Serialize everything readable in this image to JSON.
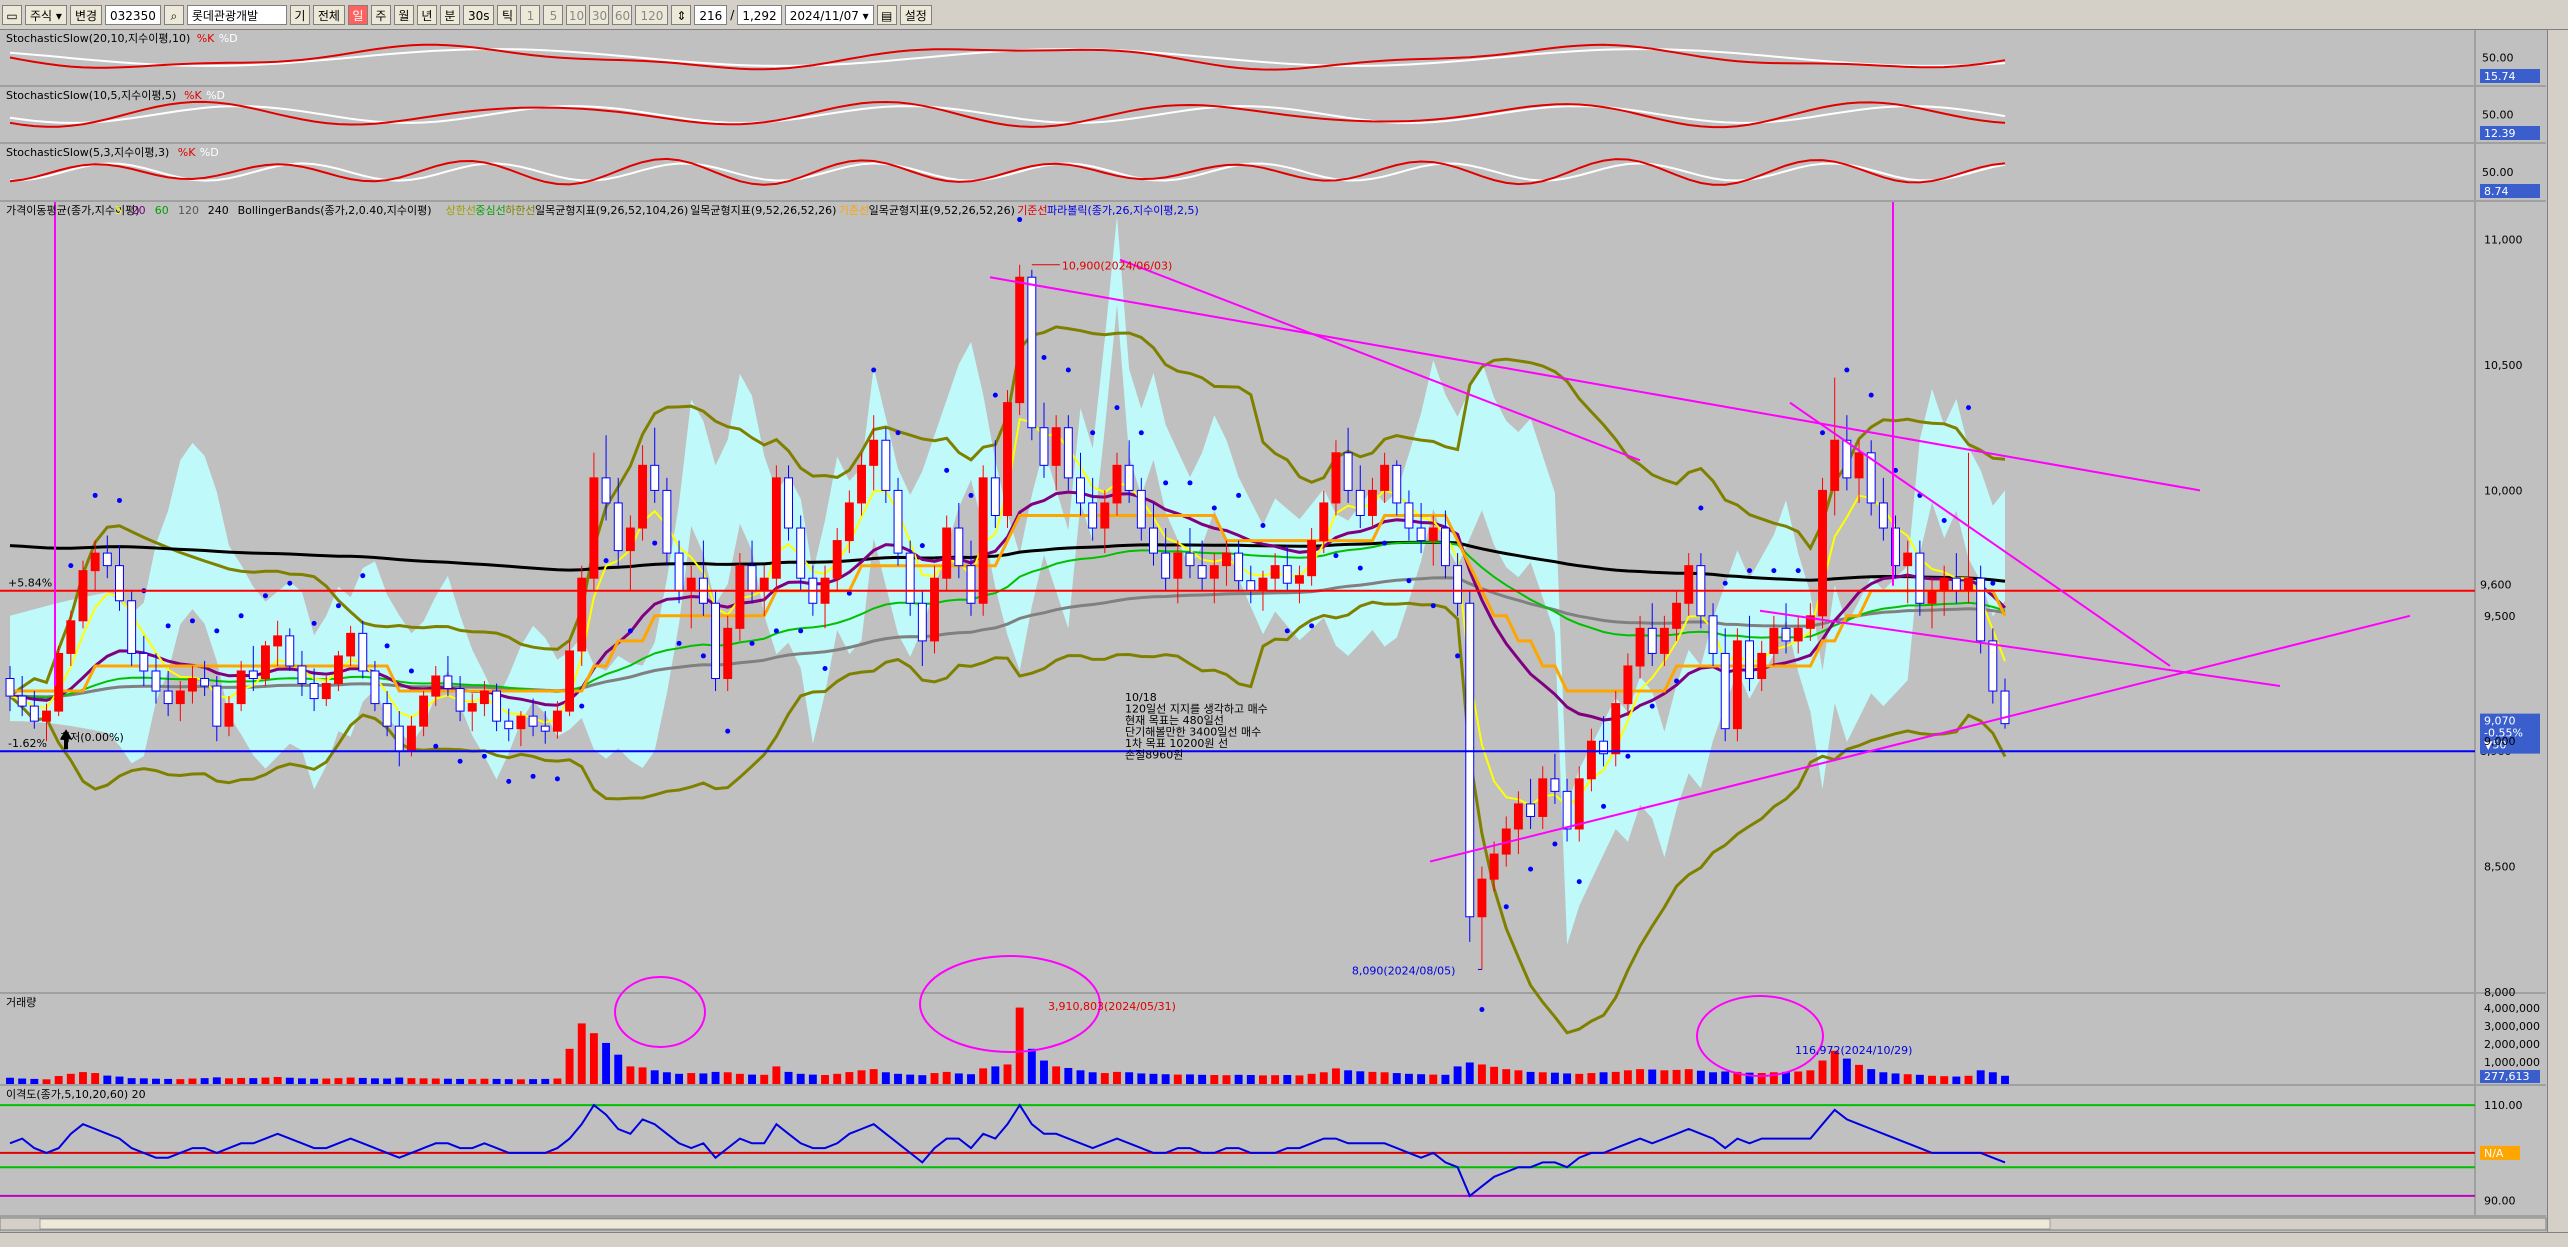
{
  "toolbar": {
    "market_label": "주식",
    "change_label": "변경",
    "code": "032350",
    "name": "롯데관광개발",
    "period_label": "기",
    "all_label": "전체",
    "day_label": "일",
    "week_label": "주",
    "month_label": "월",
    "year_label": "년",
    "minute_label": "분",
    "sec30_label": "30s",
    "tick_label": "틱",
    "intervals": [
      "1",
      "5",
      "10",
      "30",
      "60",
      "120"
    ],
    "count": "216",
    "zoom": "1,292",
    "date": "2024/11/07",
    "settings_label": "설정"
  },
  "colors": {
    "candle_up": "#ff0000",
    "candle_down": "#0000ff",
    "ichimoku_cloud": "#c0ffff",
    "ma5": "#ffff00",
    "ma20": "#800080",
    "ma60": "#00c000",
    "ma120": "#808080",
    "ma240": "#000000",
    "bollinger": "#808000",
    "envelope": "#ffa500",
    "trendline": "#ff00ff",
    "support": "#0000ff",
    "resistance": "#ff0000"
  },
  "panels": {
    "stoch1": {
      "title": "StochasticSlow(20,10,지수이평,10)",
      "k": "%K",
      "d": "%D",
      "level": "50.00",
      "value": "15.74"
    },
    "stoch2": {
      "title": "StochasticSlow(10,5,지수이평,5)",
      "k": "%K",
      "d": "%D",
      "level": "50.00",
      "value": "12.39"
    },
    "stoch3": {
      "title": "StochasticSlow(5,3,지수이평,3)",
      "k": "%K",
      "d": "%D",
      "level": "50.00",
      "value": "8.74"
    },
    "price": {
      "legend": [
        "가격이동평균(종가,지수이평)",
        "5",
        "20",
        "60",
        "120",
        "240",
        "BollingerBands(종가,2,0.40,지수이평)",
        "상한선",
        "중심선",
        "하한선",
        "일목균형지표(9,26,52,104,26)",
        "일목균형지표(9,52,26,52,26)",
        "기준선",
        "일목균형지표(9,52,26,52,26)",
        "기준선",
        "파라볼릭(종가,26,지수이평,2,5)"
      ],
      "high_label": "10,900(2024/06/03)",
      "low_label": "8,090(2024/08/05)",
      "ref_high": "+5.84%",
      "ref_low": "-1.62%",
      "low_marker": "최저(0.00%)",
      "note": [
        "10/18",
        "120일선 지지를 생각하고 매수",
        "현재 목표는 480일선",
        "단기해볼만한 3400일선 매수",
        "1차 목표 10200원 선",
        "손절8960원"
      ],
      "resistance": "9,600",
      "support": "8,960",
      "current_price": "9,070",
      "current_change": "-0.55%",
      "current_diff": "▼50",
      "ticks": [
        "11,000",
        "10,500",
        "10,000",
        "9,500",
        "9,000",
        "8,500",
        "8,000"
      ]
    },
    "volume": {
      "title": "거래량",
      "peak1": "3,910,803(2024/05/31)",
      "peak2": "116,972(2024/10/29)",
      "ticks": [
        "4,000,000",
        "3,000,000",
        "2,000,000",
        "1,000,000"
      ],
      "last": "277,613"
    },
    "disparity": {
      "title": "이격도(종가,5,10,20,60)",
      "param": "20",
      "ticks": [
        "110.00",
        "90.00"
      ],
      "value": "N/A"
    }
  },
  "chart_data": {
    "type": "candlestick",
    "title": "롯데관광개발",
    "ylim": [
      8000,
      11150
    ],
    "resistance": 9600,
    "support": 8960,
    "high": {
      "value": 10900,
      "date": "2024/06/03"
    },
    "low": {
      "value": 8090,
      "date": "2024/08/05"
    },
    "candles": [
      [
        9250,
        9300,
        9120,
        9180
      ],
      [
        9180,
        9260,
        9100,
        9140
      ],
      [
        9140,
        9200,
        9050,
        9080
      ],
      [
        9080,
        9150,
        9000,
        9120
      ],
      [
        9120,
        9380,
        9100,
        9350
      ],
      [
        9350,
        9520,
        9300,
        9480
      ],
      [
        9480,
        9720,
        9450,
        9680
      ],
      [
        9680,
        9800,
        9600,
        9750
      ],
      [
        9750,
        9820,
        9650,
        9700
      ],
      [
        9700,
        9780,
        9520,
        9560
      ],
      [
        9560,
        9600,
        9300,
        9350
      ],
      [
        9350,
        9420,
        9220,
        9280
      ],
      [
        9280,
        9350,
        9150,
        9200
      ],
      [
        9200,
        9280,
        9100,
        9150
      ],
      [
        9150,
        9240,
        9080,
        9200
      ],
      [
        9200,
        9300,
        9150,
        9250
      ],
      [
        9250,
        9320,
        9180,
        9220
      ],
      [
        9220,
        9260,
        9000,
        9060
      ],
      [
        9060,
        9180,
        9020,
        9150
      ],
      [
        9150,
        9320,
        9120,
        9280
      ],
      [
        9280,
        9380,
        9200,
        9250
      ],
      [
        9250,
        9400,
        9220,
        9380
      ],
      [
        9380,
        9480,
        9300,
        9420
      ],
      [
        9420,
        9450,
        9280,
        9300
      ],
      [
        9300,
        9360,
        9180,
        9230
      ],
      [
        9230,
        9290,
        9120,
        9170
      ],
      [
        9170,
        9260,
        9140,
        9230
      ],
      [
        9230,
        9360,
        9200,
        9340
      ],
      [
        9340,
        9460,
        9300,
        9430
      ],
      [
        9430,
        9480,
        9250,
        9280
      ],
      [
        9280,
        9320,
        9120,
        9150
      ],
      [
        9150,
        9200,
        9020,
        9060
      ],
      [
        9060,
        9120,
        8900,
        8960
      ],
      [
        8960,
        9100,
        8940,
        9060
      ],
      [
        9060,
        9200,
        9020,
        9180
      ],
      [
        9180,
        9300,
        9140,
        9260
      ],
      [
        9260,
        9340,
        9180,
        9210
      ],
      [
        9210,
        9260,
        9080,
        9120
      ],
      [
        9120,
        9190,
        9040,
        9150
      ],
      [
        9150,
        9240,
        9100,
        9200
      ],
      [
        9200,
        9230,
        9040,
        9080
      ],
      [
        9080,
        9130,
        9000,
        9050
      ],
      [
        9050,
        9120,
        8980,
        9100
      ],
      [
        9100,
        9170,
        9020,
        9060
      ],
      [
        9060,
        9120,
        8990,
        9040
      ],
      [
        9040,
        9160,
        9010,
        9120
      ],
      [
        9120,
        9400,
        9100,
        9360
      ],
      [
        9360,
        9700,
        9300,
        9650
      ],
      [
        9650,
        10150,
        9600,
        10050
      ],
      [
        10050,
        10220,
        9880,
        9950
      ],
      [
        9950,
        10050,
        9700,
        9760
      ],
      [
        9760,
        9900,
        9600,
        9850
      ],
      [
        9850,
        10180,
        9800,
        10100
      ],
      [
        10100,
        10250,
        9950,
        10000
      ],
      [
        10000,
        10050,
        9700,
        9750
      ],
      [
        9750,
        9800,
        9550,
        9600
      ],
      [
        9600,
        9700,
        9450,
        9650
      ],
      [
        9650,
        9800,
        9500,
        9550
      ],
      [
        9550,
        9600,
        9200,
        9250
      ],
      [
        9250,
        9500,
        9200,
        9450
      ],
      [
        9450,
        9750,
        9400,
        9700
      ],
      [
        9700,
        9800,
        9550,
        9600
      ],
      [
        9600,
        9700,
        9500,
        9650
      ],
      [
        9650,
        10100,
        9600,
        10050
      ],
      [
        10050,
        10100,
        9800,
        9850
      ],
      [
        9850,
        9900,
        9600,
        9650
      ],
      [
        9650,
        9700,
        9500,
        9550
      ],
      [
        9550,
        9700,
        9450,
        9650
      ],
      [
        9650,
        9850,
        9600,
        9800
      ],
      [
        9800,
        10000,
        9750,
        9950
      ],
      [
        9950,
        10150,
        9900,
        10100
      ],
      [
        10100,
        10300,
        10000,
        10200
      ],
      [
        10200,
        10250,
        9950,
        10000
      ],
      [
        10000,
        10050,
        9700,
        9750
      ],
      [
        9750,
        9800,
        9500,
        9550
      ],
      [
        9550,
        9600,
        9300,
        9400
      ],
      [
        9400,
        9700,
        9350,
        9650
      ],
      [
        9650,
        9900,
        9600,
        9850
      ],
      [
        9850,
        9950,
        9650,
        9700
      ],
      [
        9700,
        9800,
        9500,
        9550
      ],
      [
        9550,
        10100,
        9500,
        10050
      ],
      [
        10050,
        10200,
        9850,
        9900
      ],
      [
        9900,
        10400,
        9850,
        10350
      ],
      [
        10350,
        10900,
        10300,
        10850
      ],
      [
        10850,
        10880,
        10200,
        10250
      ],
      [
        10250,
        10350,
        10050,
        10100
      ],
      [
        10100,
        10300,
        10000,
        10250
      ],
      [
        10250,
        10300,
        10000,
        10050
      ],
      [
        10050,
        10150,
        9900,
        9950
      ],
      [
        9950,
        10050,
        9800,
        9850
      ],
      [
        9850,
        10000,
        9750,
        9950
      ],
      [
        9950,
        10150,
        9900,
        10100
      ],
      [
        10100,
        10200,
        9950,
        10000
      ],
      [
        10000,
        10050,
        9800,
        9850
      ],
      [
        9850,
        9950,
        9700,
        9750
      ],
      [
        9750,
        9850,
        9600,
        9650
      ],
      [
        9650,
        9800,
        9550,
        9750
      ],
      [
        9750,
        9850,
        9650,
        9700
      ],
      [
        9700,
        9800,
        9600,
        9650
      ],
      [
        9650,
        9750,
        9550,
        9700
      ],
      [
        9700,
        9800,
        9620,
        9750
      ],
      [
        9750,
        9800,
        9600,
        9640
      ],
      [
        9640,
        9700,
        9550,
        9600
      ],
      [
        9600,
        9680,
        9520,
        9650
      ],
      [
        9650,
        9750,
        9600,
        9700
      ],
      [
        9700,
        9780,
        9600,
        9630
      ],
      [
        9630,
        9700,
        9550,
        9660
      ],
      [
        9660,
        9850,
        9620,
        9800
      ],
      [
        9800,
        10000,
        9750,
        9950
      ],
      [
        9950,
        10200,
        9900,
        10150
      ],
      [
        10150,
        10250,
        9950,
        10000
      ],
      [
        10000,
        10100,
        9850,
        9900
      ],
      [
        9900,
        10050,
        9850,
        10000
      ],
      [
        10000,
        10150,
        9950,
        10100
      ],
      [
        10100,
        10120,
        9900,
        9950
      ],
      [
        9950,
        10000,
        9800,
        9850
      ],
      [
        9850,
        9950,
        9750,
        9800
      ],
      [
        9800,
        9900,
        9700,
        9850
      ],
      [
        9850,
        9920,
        9650,
        9700
      ],
      [
        9700,
        9750,
        9500,
        9550
      ],
      [
        9550,
        9600,
        8200,
        8300
      ],
      [
        8300,
        8500,
        8090,
        8450
      ],
      [
        8450,
        8600,
        8400,
        8550
      ],
      [
        8550,
        8700,
        8500,
        8650
      ],
      [
        8650,
        8800,
        8550,
        8750
      ],
      [
        8750,
        8850,
        8650,
        8700
      ],
      [
        8700,
        8900,
        8650,
        8850
      ],
      [
        8850,
        8950,
        8750,
        8800
      ],
      [
        8800,
        8850,
        8600,
        8650
      ],
      [
        8650,
        8900,
        8600,
        8850
      ],
      [
        8850,
        9050,
        8800,
        9000
      ],
      [
        9000,
        9100,
        8900,
        8950
      ],
      [
        8950,
        9200,
        8900,
        9150
      ],
      [
        9150,
        9350,
        9100,
        9300
      ],
      [
        9300,
        9500,
        9250,
        9450
      ],
      [
        9450,
        9550,
        9300,
        9350
      ],
      [
        9350,
        9500,
        9300,
        9450
      ],
      [
        9450,
        9600,
        9400,
        9550
      ],
      [
        9550,
        9750,
        9500,
        9700
      ],
      [
        9700,
        9750,
        9450,
        9500
      ],
      [
        9500,
        9550,
        9300,
        9350
      ],
      [
        9350,
        9450,
        9000,
        9050
      ],
      [
        9050,
        9450,
        9000,
        9400
      ],
      [
        9400,
        9500,
        9200,
        9250
      ],
      [
        9250,
        9400,
        9200,
        9350
      ],
      [
        9350,
        9500,
        9300,
        9450
      ],
      [
        9450,
        9550,
        9350,
        9400
      ],
      [
        9400,
        9500,
        9350,
        9450
      ],
      [
        9450,
        9550,
        9400,
        9500
      ],
      [
        9500,
        10050,
        9450,
        10000
      ],
      [
        10000,
        10450,
        9900,
        10200
      ],
      [
        10200,
        10300,
        10000,
        10050
      ],
      [
        10050,
        10200,
        9950,
        10150
      ],
      [
        10150,
        10200,
        9900,
        9950
      ],
      [
        9950,
        10050,
        9800,
        9850
      ],
      [
        9850,
        9900,
        9650,
        9700
      ],
      [
        9700,
        9800,
        9550,
        9750
      ],
      [
        9750,
        9800,
        9500,
        9550
      ],
      [
        9550,
        9650,
        9450,
        9600
      ],
      [
        9600,
        9700,
        9500,
        9650
      ],
      [
        9650,
        9750,
        9550,
        9600
      ],
      [
        9600,
        10150,
        9550,
        9650
      ],
      [
        9650,
        9700,
        9350,
        9400
      ],
      [
        9400,
        9450,
        9150,
        9200
      ],
      [
        9200,
        9250,
        9050,
        9070
      ]
    ],
    "volume": [
      320,
      280,
      260,
      240,
      410,
      520,
      610,
      560,
      430,
      380,
      300,
      290,
      270,
      260,
      250,
      280,
      300,
      340,
      290,
      310,
      300,
      330,
      360,
      320,
      290,
      270,
      280,
      300,
      330,
      310,
      290,
      280,
      330,
      300,
      290,
      280,
      270,
      260,
      250,
      270,
      260,
      250,
      240,
      250,
      260,
      280,
      1800,
      3100,
      2600,
      2100,
      1500,
      900,
      850,
      700,
      600,
      520,
      560,
      540,
      620,
      600,
      520,
      480,
      470,
      900,
      620,
      520,
      480,
      460,
      520,
      610,
      700,
      760,
      600,
      520,
      480,
      450,
      560,
      620,
      540,
      500,
      800,
      900,
      1000,
      3910,
      1800,
      1200,
      900,
      820,
      700,
      600,
      560,
      620,
      600,
      540,
      520,
      500,
      480,
      490,
      470,
      460,
      450,
      470,
      460,
      440,
      450,
      460,
      440,
      520,
      600,
      800,
      700,
      650,
      620,
      600,
      560,
      520,
      500,
      480,
      470,
      900,
      1100,
      1000,
      880,
      760,
      700,
      620,
      600,
      580,
      540,
      520,
      560,
      600,
      620,
      700,
      760,
      740,
      700,
      720,
      760,
      680,
      600,
      640,
      620,
      580,
      560,
      600,
      620,
      640,
      700,
      1200,
      1700,
      1300,
      980,
      760,
      600,
      540,
      500,
      470,
      420,
      400,
      380,
      420,
      700,
      600,
      420
    ],
    "disparity": [
      102,
      103,
      101,
      100,
      101,
      104,
      106,
      105,
      104,
      103,
      101,
      100,
      99,
      99,
      100,
      101,
      101,
      100,
      101,
      102,
      102,
      103,
      104,
      103,
      102,
      101,
      101,
      102,
      103,
      102,
      101,
      100,
      99,
      100,
      101,
      102,
      102,
      101,
      101,
      102,
      101,
      100,
      100,
      100,
      100,
      101,
      103,
      106,
      110,
      108,
      105,
      104,
      107,
      106,
      104,
      102,
      101,
      102,
      99,
      101,
      103,
      102,
      102,
      106,
      104,
      102,
      101,
      101,
      102,
      104,
      105,
      106,
      104,
      102,
      100,
      98,
      101,
      103,
      103,
      101,
      104,
      103,
      106,
      110,
      106,
      104,
      104,
      103,
      102,
      101,
      102,
      103,
      102,
      101,
      100,
      100,
      101,
      101,
      100,
      100,
      101,
      101,
      100,
      100,
      100,
      101,
      101,
      102,
      103,
      103,
      102,
      102,
      102,
      102,
      101,
      100,
      99,
      100,
      98,
      97,
      91,
      93,
      95,
      96,
      97,
      97,
      98,
      98,
      97,
      99,
      100,
      100,
      101,
      102,
      103,
      102,
      103,
      104,
      105,
      104,
      103,
      101,
      103,
      102,
      103,
      103,
      103,
      103,
      103,
      106,
      109,
      107,
      106,
      105,
      104,
      103,
      102,
      101,
      100,
      100,
      100,
      100,
      100,
      99,
      98
    ]
  }
}
